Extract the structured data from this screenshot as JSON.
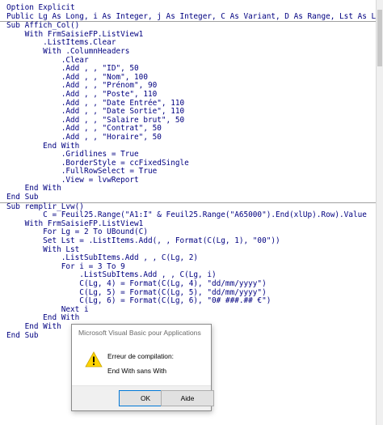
{
  "code": {
    "lines": [
      "Option Explicit",
      "Public Lg As Long, i As Integer, j As Integer, C As Variant, D As Range, Lst As ListI",
      "---",
      "Sub Affich_Col()",
      "    With FrmSaisieFP.ListView1",
      "        .ListItems.Clear",
      "        With .ColumnHeaders",
      "            .Clear",
      "            .Add , , \"ID\", 50",
      "            .Add , , \"Nom\", 100",
      "            .Add , , \"Prénom\", 90",
      "            .Add , , \"Poste\", 110",
      "            .Add , , \"Date Entrée\", 110",
      "            .Add , , \"Date Sortie\", 110",
      "            .Add , , \"Salaire brut\", 50",
      "            .Add , , \"Contrat\", 50",
      "            .Add , , \"Horaire\", 50",
      "        End With",
      "            .Gridlines = True",
      "            .BorderStyle = ccFixedSingle",
      "            .FullRowSelect = True",
      "            .View = lvwReport",
      "    End With",
      "End Sub",
      "---",
      "Sub remplir_Lvw()",
      "        C = Feuil25.Range(\"A1:I\" & Feuil25.Range(\"A65000\").End(xlUp).Row).Value",
      "    With FrmSaisieFP.ListView1",
      "        For Lg = 2 To UBound(C)",
      "        Set Lst = .ListItems.Add(, , Format(C(Lg, 1), \"00\"))",
      "        With Lst",
      "            .ListSubItems.Add , , C(Lg, 2)",
      "            For i = 3 To 9",
      "                .ListSubItems.Add , , C(Lg, i)",
      "                C(Lg, 4) = Format(C(Lg, 4), \"dd/mm/yyyy\")",
      "                C(Lg, 5) = Format(C(Lg, 5), \"dd/mm/yyyy\")",
      "                C(Lg, 6) = Format(C(Lg, 6), \"0# ###.## €\")",
      "            Next i",
      "        End With",
      "    End With",
      "End Sub"
    ]
  },
  "dialog": {
    "title": "Microsoft Visual Basic pour Applications",
    "message_title": "Erreur de compilation:",
    "message_detail": "End With sans With",
    "ok_label": "OK",
    "help_label": "Aide",
    "icon": "warning-icon"
  },
  "colors": {
    "code_text": "#000080",
    "warning_fill": "#ffd400",
    "focus_border": "#0078d7"
  }
}
